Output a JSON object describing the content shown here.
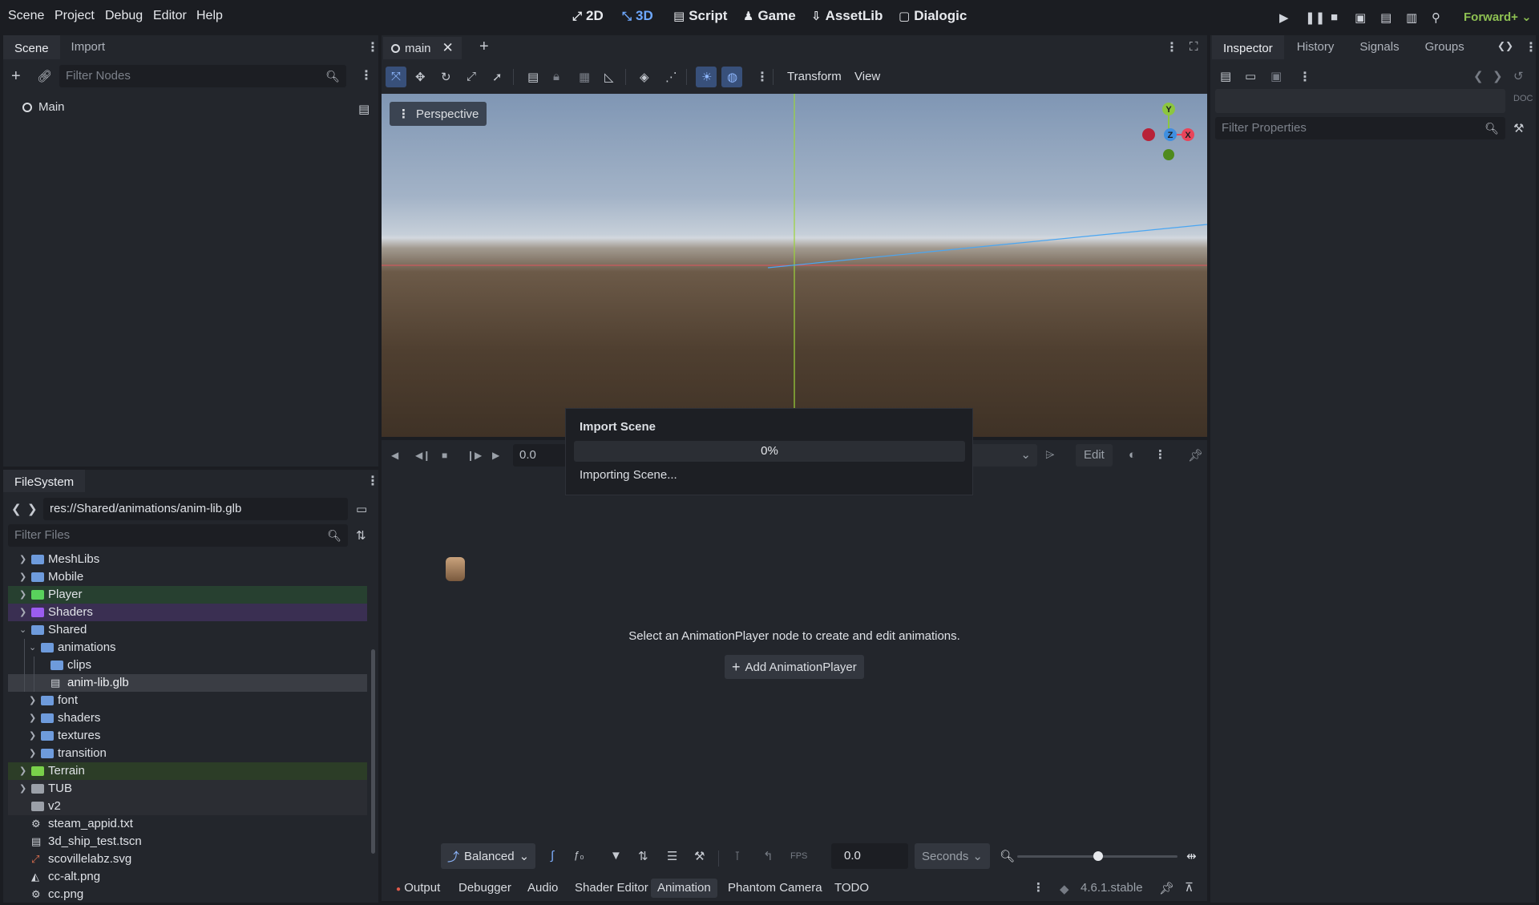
{
  "menu": {
    "scene": "Scene",
    "project": "Project",
    "debug": "Debug",
    "editor": "Editor",
    "help": "Help"
  },
  "workspaces": {
    "w2d": "2D",
    "w3d": "3D",
    "script": "Script",
    "game": "Game",
    "assetlib": "AssetLib",
    "dialogic": "Dialogic"
  },
  "renderer": "Forward+",
  "scene_dock": {
    "tabs": {
      "scene": "Scene",
      "import": "Import"
    },
    "filter_placeholder": "Filter Nodes",
    "root_node": "Main"
  },
  "filesystem": {
    "tab": "FileSystem",
    "path": "res://Shared/animations/anim-lib.glb",
    "filter_placeholder": "Filter Files",
    "items": [
      {
        "name": "MeshLibs"
      },
      {
        "name": "Mobile"
      },
      {
        "name": "Player"
      },
      {
        "name": "Shaders"
      },
      {
        "name": "Shared"
      },
      {
        "name": "animations"
      },
      {
        "name": "clips"
      },
      {
        "name": "anim-lib.glb"
      },
      {
        "name": "font"
      },
      {
        "name": "shaders"
      },
      {
        "name": "textures"
      },
      {
        "name": "transition"
      },
      {
        "name": "Terrain"
      },
      {
        "name": "TUB"
      },
      {
        "name": "v2"
      },
      {
        "name": "steam_appid.txt"
      },
      {
        "name": "3d_ship_test.tscn"
      },
      {
        "name": "scovillelabz.svg"
      },
      {
        "name": "cc-alt.png"
      },
      {
        "name": "cc.png"
      }
    ]
  },
  "editor_tabs": {
    "main": "main"
  },
  "viewport_toolbar": {
    "transform": "Transform",
    "view": "View"
  },
  "viewport": {
    "perspective": "Perspective",
    "gizmo": {
      "y": "Y",
      "z": "Z",
      "x": "X"
    }
  },
  "animation": {
    "time": "0.0",
    "edit": "Edit",
    "empty_message": "Select an AnimationPlayer node to create and edit animations.",
    "add_button": "Add AnimationPlayer",
    "snap_mode": "Balanced",
    "step_value": "0.0",
    "step_unit": "Seconds",
    "fps": "FPS"
  },
  "import_dialog": {
    "title": "Import Scene",
    "progress_text": "0%",
    "progress": 0,
    "status": "Importing Scene..."
  },
  "bottom_tabs": {
    "output": "Output",
    "debugger": "Debugger",
    "audio": "Audio",
    "shader_editor": "Shader Editor",
    "animation": "Animation",
    "phantom_camera": "Phantom Camera",
    "todo": "TODO",
    "version": "4.6.1.stable"
  },
  "inspector": {
    "tabs": {
      "inspector": "Inspector",
      "history": "History",
      "signals": "Signals",
      "groups": "Groups"
    },
    "filter_placeholder": "Filter Properties"
  },
  "colors": {
    "accent": "#6ea8ff",
    "renderer": "#8ec152",
    "player_row": "#274030",
    "shaders_row": "#3a2f52",
    "terrain_row": "#2c3d27"
  }
}
